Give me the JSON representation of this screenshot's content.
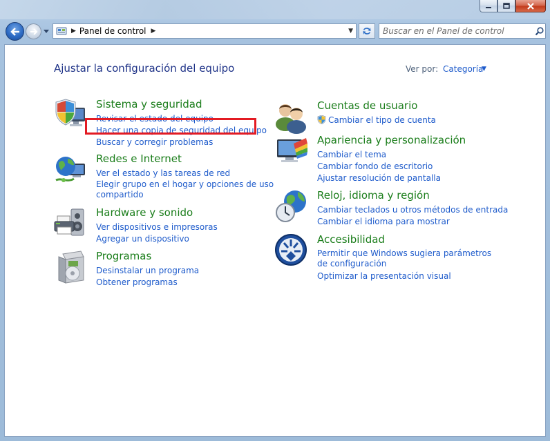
{
  "window": {
    "address": {
      "crumb": "Panel de control"
    },
    "search": {
      "placeholder": "Buscar en el Panel de control"
    }
  },
  "content": {
    "title": "Ajustar la configuración del equipo",
    "view_by_label": "Ver por:",
    "view_by_value": "Categoría"
  },
  "categories": {
    "system_security": {
      "heading": "Sistema y seguridad",
      "links": [
        "Revisar el estado del equipo",
        "Hacer una copia de seguridad del equipo",
        "Buscar y corregir problemas"
      ]
    },
    "network": {
      "heading": "Redes e Internet",
      "links": [
        "Ver el estado y las tareas de red",
        "Elegir grupo en el hogar y opciones de uso compartido"
      ]
    },
    "hardware": {
      "heading": "Hardware y sonido",
      "links": [
        "Ver dispositivos e impresoras",
        "Agregar un dispositivo"
      ]
    },
    "programs": {
      "heading": "Programas",
      "links": [
        "Desinstalar un programa",
        "Obtener programas"
      ]
    },
    "user_accounts": {
      "heading": "Cuentas de usuario",
      "links": [
        "Cambiar el tipo de cuenta"
      ]
    },
    "appearance": {
      "heading": "Apariencia y personalización",
      "links": [
        "Cambiar el tema",
        "Cambiar fondo de escritorio",
        "Ajustar resolución de pantalla"
      ]
    },
    "clock": {
      "heading": "Reloj, idioma y región",
      "links": [
        "Cambiar teclados u otros métodos de entrada",
        "Cambiar el idioma para mostrar"
      ]
    },
    "accessibility": {
      "heading": "Accesibilidad",
      "links": [
        "Permitir que Windows sugiera parámetros de configuración",
        "Optimizar la presentación visual"
      ]
    }
  },
  "colors": {
    "heading": "#1a7d1a",
    "link": "#1e5bcb",
    "title": "#1e3287",
    "highlight": "#e31b23"
  },
  "icons": {
    "system_security": "shield-monitor-icon",
    "network": "globe-network-icon",
    "hardware": "printer-speaker-icon",
    "programs": "software-box-icon",
    "user_accounts": "users-icon",
    "appearance": "display-palette-icon",
    "clock": "clock-globe-icon",
    "accessibility": "accessibility-icon"
  }
}
